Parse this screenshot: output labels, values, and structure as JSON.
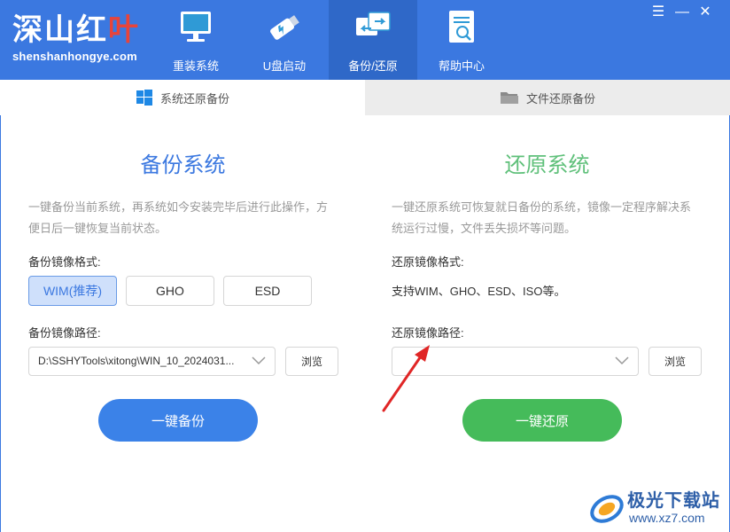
{
  "app": {
    "logo_text": "深山红",
    "logo_leaf": "叶",
    "logo_sub": "shenshanhongye.com"
  },
  "nav": {
    "items": [
      {
        "label": "重装系统",
        "icon": "monitor-icon"
      },
      {
        "label": "U盘启动",
        "icon": "usb-drive-icon"
      },
      {
        "label": "备份/还原",
        "icon": "backup-restore-icon"
      },
      {
        "label": "帮助中心",
        "icon": "help-document-icon"
      }
    ],
    "active_index": 2
  },
  "window_controls": {
    "menu": "☰",
    "minimize": "—",
    "close": "✕"
  },
  "tabs": {
    "system": "系统还原备份",
    "file": "文件还原备份"
  },
  "backup": {
    "title": "备份系统",
    "desc": "一键备份当前系统，再系统如今安装完毕后进行此操作，方便日后一键恢复当前状态。",
    "format_label": "备份镜像格式:",
    "formats": [
      "WIM(推荐)",
      "GHO",
      "ESD"
    ],
    "selected_format": "WIM(推荐)",
    "path_label": "备份镜像路径:",
    "path_value": "D:\\SSHYTools\\xitong\\WIN_10_2024031...",
    "browse": "浏览",
    "action": "一键备份"
  },
  "restore": {
    "title": "还原系统",
    "desc": "一键还原系统可恢复就日备份的系统，镜像一定程序解决系统运行过慢，文件丢失损坏等问题。",
    "format_label": "还原镜像格式:",
    "support_text": "支持WIM、GHO、ESD、ISO等。",
    "path_label": "还原镜像路径:",
    "path_value": "",
    "browse": "浏览",
    "action": "一键还原"
  },
  "watermark": {
    "name": "极光下载站",
    "url": "www.xz7.com"
  },
  "colors": {
    "header": "#3b78e0",
    "accent_blue": "#3b82e8",
    "accent_green": "#45bb5a",
    "title_blue": "#3b78e0",
    "title_green": "#5fc07a",
    "annotation_red": "#e02626"
  }
}
